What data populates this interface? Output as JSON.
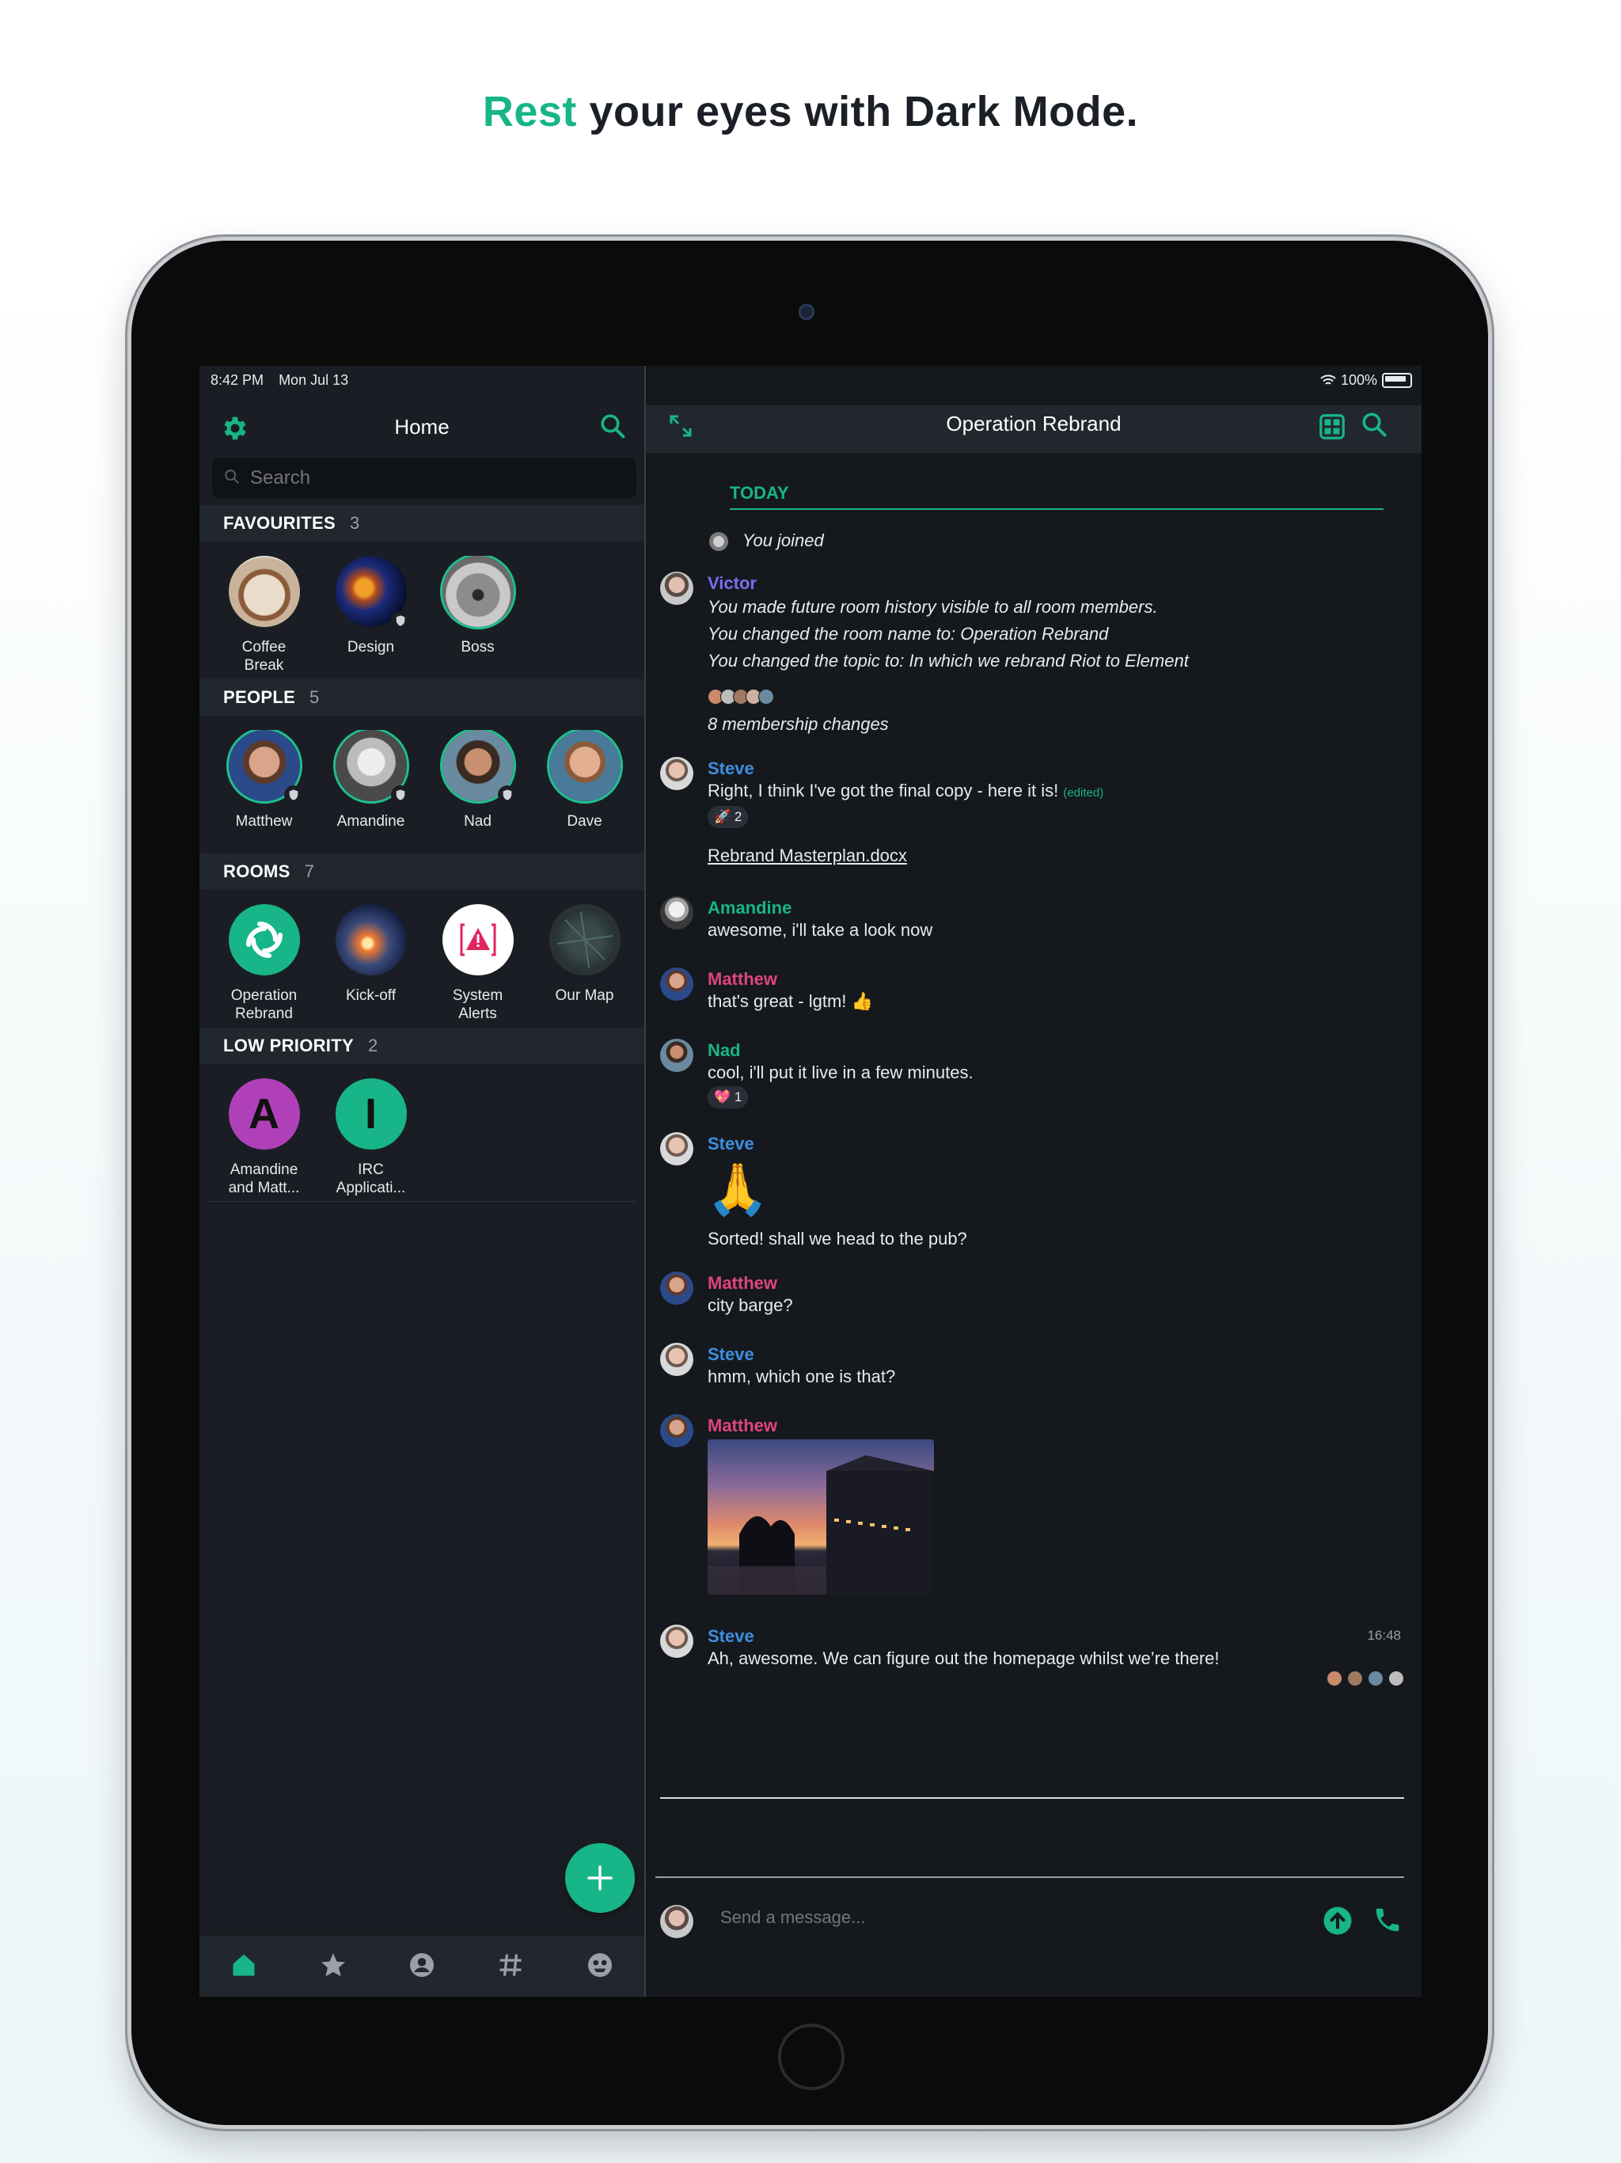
{
  "headline": {
    "accent": "Rest",
    "rest": "your eyes with Dark Mode."
  },
  "status": {
    "time": "8:42 PM",
    "date": "Mon Jul 13",
    "battery": "100%"
  },
  "left": {
    "title": "Home",
    "search_placeholder": "Search",
    "sections": {
      "favourites": {
        "title": "FAVOURITES",
        "count": "3"
      },
      "people": {
        "title": "PEOPLE",
        "count": "5"
      },
      "rooms": {
        "title": "ROOMS",
        "count": "7"
      },
      "low_priority": {
        "title": "LOW PRIORITY",
        "count": "2"
      }
    },
    "favourites": [
      {
        "line1": "Coffee",
        "line2": "Break"
      },
      {
        "line1": "Design",
        "line2": ""
      },
      {
        "line1": "Boss",
        "line2": ""
      }
    ],
    "people": [
      {
        "name": "Matthew"
      },
      {
        "name": "Amandine"
      },
      {
        "name": "Nad"
      },
      {
        "name": "Dave"
      }
    ],
    "rooms": [
      {
        "line1": "Operation",
        "line2": "Rebrand"
      },
      {
        "line1": "Kick-off",
        "line2": ""
      },
      {
        "line1": "System",
        "line2": "Alerts"
      },
      {
        "line1": "Our Map",
        "line2": ""
      }
    ],
    "low_priority": [
      {
        "letter": "A",
        "line1": "Amandine",
        "line2": "and Matt...",
        "color": "#b040b8"
      },
      {
        "letter": "I",
        "line1": "IRC",
        "line2": "Applicati...",
        "color": "#17b587"
      }
    ],
    "nav": [
      "home-icon",
      "star-icon",
      "person-icon",
      "hash-icon",
      "globe-icon"
    ]
  },
  "room": {
    "title": "Operation Rebrand",
    "today": "TODAY",
    "you_joined": "You joined",
    "victor": {
      "name": "Victor",
      "lines": [
        "You made future room history visible to all room members.",
        "You changed the room name to: Operation Rebrand",
        "You changed the topic to: In which we rebrand Riot to Element"
      ]
    },
    "membership": "8 membership changes",
    "steve1": {
      "name": "Steve",
      "text": "Right, I think I've got the final copy - here it is!",
      "edited": "(edited)",
      "reaction": "🚀 2"
    },
    "file": "Rebrand Masterplan.docx",
    "amandine": {
      "name": "Amandine",
      "text": "awesome, i'll take a look now"
    },
    "matthew1": {
      "name": "Matthew",
      "text": "that's great - lgtm! 👍"
    },
    "nad": {
      "name": "Nad",
      "text": "cool, i'll put it live in a few minutes.",
      "reaction": "💖 1"
    },
    "steve2": {
      "name": "Steve",
      "emoji": "🙏",
      "text": "Sorted! shall we head to the pub?"
    },
    "matthew2": {
      "name": "Matthew",
      "text": "city barge?"
    },
    "steve3": {
      "name": "Steve",
      "text": "hmm, which one is that?"
    },
    "matthew3": {
      "name": "Matthew"
    },
    "steve4": {
      "name": "Steve",
      "text": "Ah, awesome. We can figure out the homepage whilst we’re there!",
      "time": "16:48"
    },
    "composer_placeholder": "Send a message..."
  },
  "colors": {
    "accent": "#17b587",
    "victor": "#7c6cf0",
    "steve": "#3d8fe0",
    "amandine": "#17b587",
    "matthew": "#e0457b",
    "nad": "#17b587"
  }
}
